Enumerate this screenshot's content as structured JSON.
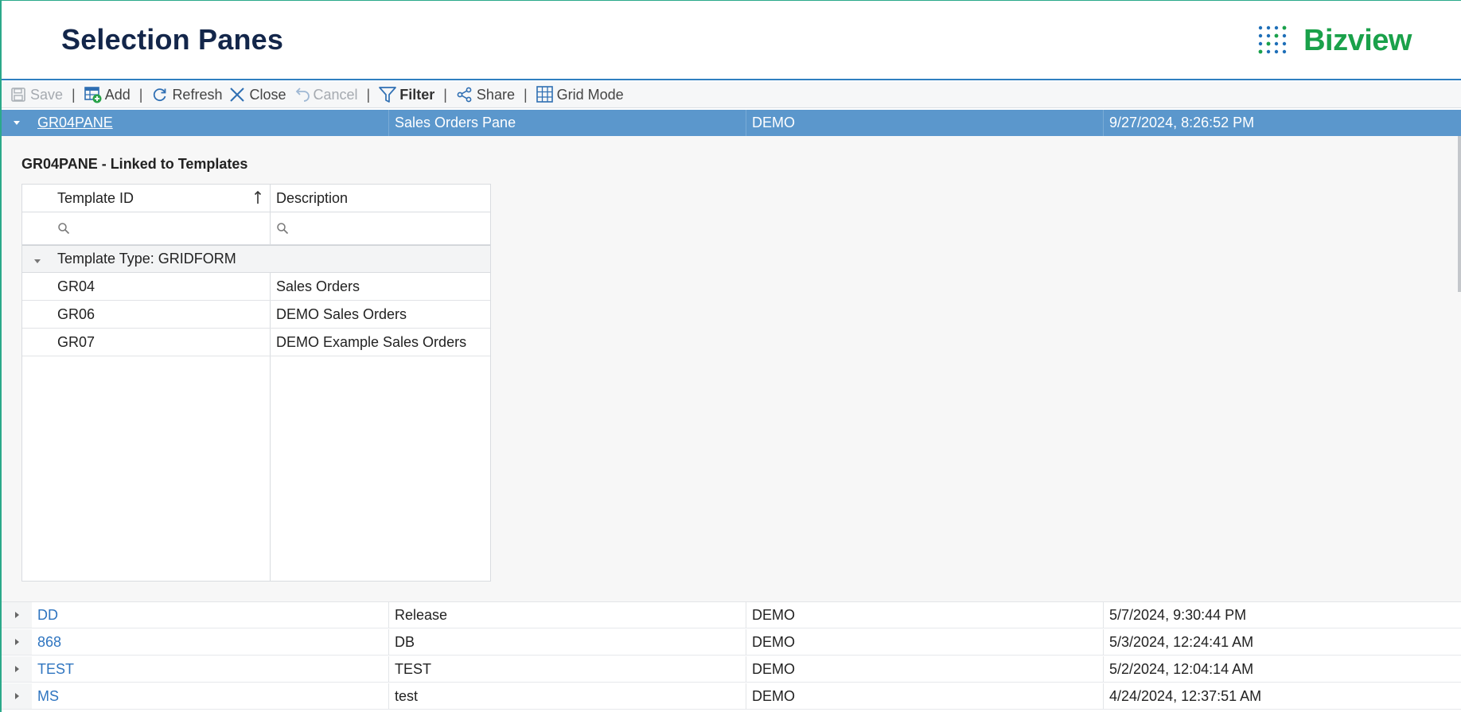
{
  "header": {
    "title": "Selection Panes",
    "logo_text": "Bizview"
  },
  "toolbar": {
    "save": "Save",
    "add": "Add",
    "refresh": "Refresh",
    "close": "Close",
    "cancel": "Cancel",
    "filter": "Filter",
    "share": "Share",
    "grid_mode": "Grid Mode",
    "separator": "|"
  },
  "selected_row": {
    "id": "GR04PANE",
    "description": "Sales Orders Pane",
    "session": "DEMO",
    "date": "9/27/2024, 8:26:52 PM"
  },
  "detail": {
    "title": "GR04PANE - Linked to Templates",
    "columns": [
      "Template ID",
      "Description"
    ],
    "group_label": "Template Type: GRIDFORM",
    "rows": [
      {
        "id": "GR04",
        "description": "Sales Orders"
      },
      {
        "id": "GR06",
        "description": "DEMO Sales Orders"
      },
      {
        "id": "GR07",
        "description": "DEMO Example Sales Orders"
      }
    ]
  },
  "rows": [
    {
      "id": "DD",
      "description": "Release",
      "session": "DEMO",
      "date": "5/7/2024, 9:30:44 PM"
    },
    {
      "id": "868",
      "description": "DB",
      "session": "DEMO",
      "date": "5/3/2024, 12:24:41 AM"
    },
    {
      "id": "TEST",
      "description": "TEST",
      "session": "DEMO",
      "date": "5/2/2024, 12:04:14 AM"
    },
    {
      "id": "MS",
      "description": "test",
      "session": "DEMO",
      "date": "4/24/2024, 12:37:51 AM"
    }
  ],
  "colors": {
    "accent": "#2f7fc0",
    "selected_row": "#5b97cc",
    "brand_green": "#1aa14a",
    "title": "#13264a",
    "link": "#2f75c0"
  },
  "icons": {
    "save": "floppy-disk-icon",
    "add": "add-grid-icon",
    "refresh": "refresh-icon",
    "close": "close-icon",
    "cancel": "undo-icon",
    "filter": "funnel-icon",
    "share": "share-icon",
    "grid_mode": "grid-icon"
  }
}
